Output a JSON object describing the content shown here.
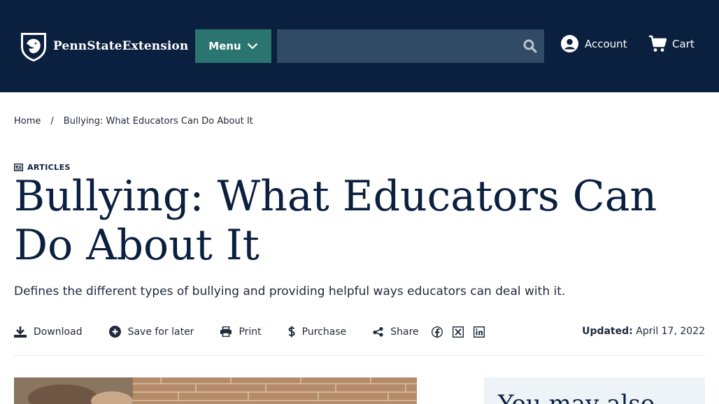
{
  "header": {
    "brand": "PennStateExtension",
    "menu_label": "Menu",
    "search": {
      "value": "",
      "placeholder": ""
    },
    "account_label": "Account",
    "cart_label": "Cart"
  },
  "breadcrumb": {
    "home": "Home",
    "separator": "/",
    "current": "Bullying: What Educators Can Do About It"
  },
  "article": {
    "type": "ARTICLES",
    "title": "Bullying: What Educators Can Do About It",
    "summary": "Defines the different types of bullying and providing helpful ways educators can deal with it.",
    "updated_label": "Updated:",
    "updated_date": "April 17, 2022"
  },
  "actions": {
    "download": "Download",
    "save": "Save for later",
    "print": "Print",
    "purchase": "Purchase",
    "share": "Share"
  },
  "sidebar": {
    "card_title": "You may also"
  },
  "icons": {
    "search": "search-icon",
    "account": "account-icon",
    "cart": "cart-icon",
    "download": "download-icon",
    "save": "plus-circle-icon",
    "print": "print-icon",
    "purchase": "dollar-icon",
    "share": "share-icon",
    "facebook": "facebook-icon",
    "x": "x-icon",
    "linkedin": "linkedin-icon"
  },
  "colors": {
    "navy": "#0b1f3f",
    "teal": "#2b7571",
    "search_bg": "#314a66"
  }
}
